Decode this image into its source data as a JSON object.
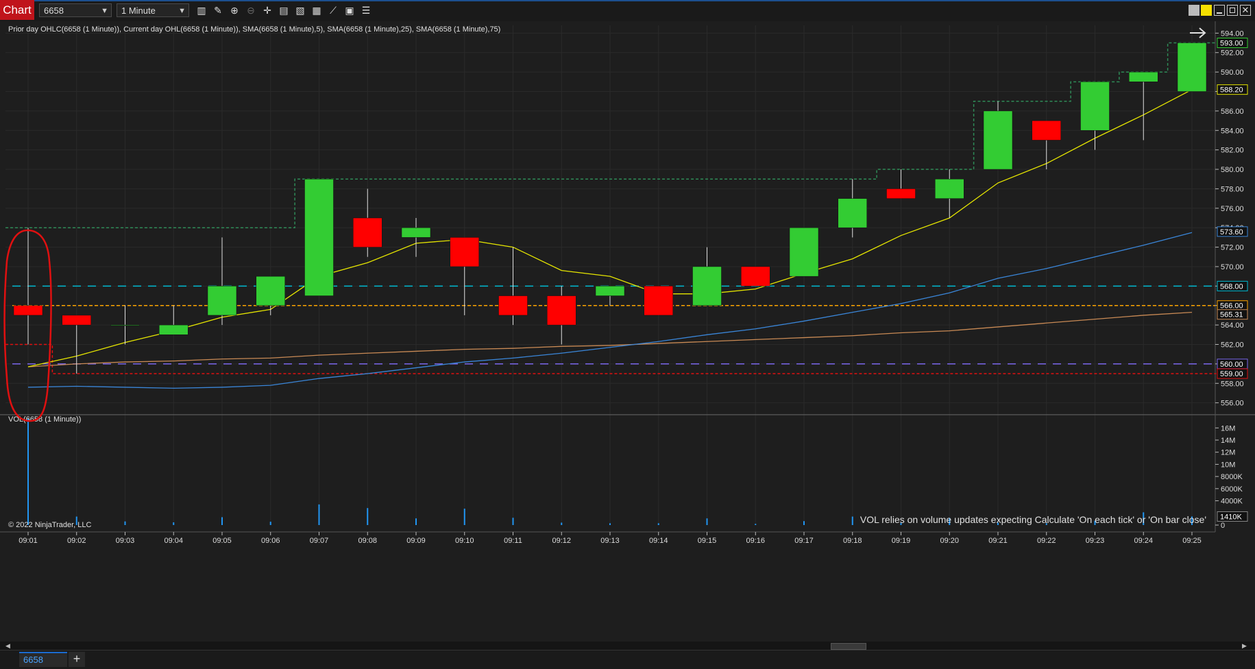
{
  "toolbar": {
    "tab_label": "Chart",
    "instrument": "6658",
    "interval": "1 Minute",
    "icons": [
      "bar-type-icon",
      "drawing-tool-icon",
      "zoom-in-icon",
      "zoom-out-icon",
      "crosshair-icon",
      "data-box-icon",
      "templates-icon",
      "strategies-icon",
      "indicators-icon",
      "properties-icon",
      "list-icon"
    ]
  },
  "colors": {
    "up": "#33cc33",
    "down": "#ff0000",
    "sma5": "#e6e600",
    "sma25": "#3a86d9",
    "sma75": "#c98a55",
    "prior_high": "#2e8b57",
    "prior_close": "#00bcd4",
    "current_open": "#ffa500",
    "prior_low": "#7b68ee",
    "current_low": "#e01010",
    "volume": "#2196f3",
    "annotation": "#e01010"
  },
  "chart_data": {
    "type": "candlestick",
    "indicator_label": "Prior day OHLC(6658 (1 Minute)), Current day OHL(6658 (1 Minute)), SMA(6658 (1 Minute),5), SMA(6658 (1 Minute),25), SMA(6658 (1 Minute),75)",
    "volume_label": "VOL(6658 (1 Minute))",
    "copyright": "© 2022 NinjaTrader, LLC",
    "volume_note": "VOL relies on volume updates expecting Calculate 'On each tick' or 'On bar close'",
    "categories": [
      "09:01",
      "09:02",
      "09:03",
      "09:04",
      "09:05",
      "09:06",
      "09:07",
      "09:08",
      "09:09",
      "09:10",
      "09:11",
      "09:12",
      "09:13",
      "09:14",
      "09:15",
      "09:16",
      "09:17",
      "09:18",
      "09:19",
      "09:20",
      "09:21",
      "09:22",
      "09:23",
      "09:24",
      "09:25"
    ],
    "ohlc": [
      [
        566,
        574,
        562,
        565
      ],
      [
        565,
        565,
        559,
        564
      ],
      [
        564,
        566,
        562,
        564
      ],
      [
        563,
        566,
        563,
        564
      ],
      [
        565,
        573,
        564,
        568
      ],
      [
        566,
        568,
        565,
        569
      ],
      [
        567,
        579,
        567,
        579
      ],
      [
        575,
        578,
        571,
        572
      ],
      [
        573,
        575,
        571,
        574
      ],
      [
        573,
        573,
        565,
        570
      ],
      [
        567,
        572,
        564,
        565
      ],
      [
        567,
        568,
        562,
        564
      ],
      [
        567,
        568,
        566,
        568
      ],
      [
        568,
        568,
        565,
        565
      ],
      [
        566,
        572,
        566,
        570
      ],
      [
        570,
        570,
        568,
        568
      ],
      [
        569,
        574,
        569,
        574
      ],
      [
        574,
        579,
        573,
        577
      ],
      [
        578,
        580,
        577,
        577
      ],
      [
        577,
        580,
        575,
        579
      ],
      [
        580,
        587,
        580,
        586
      ],
      [
        585,
        585,
        580,
        583
      ],
      [
        584,
        589,
        582,
        589
      ],
      [
        589,
        590,
        583,
        590
      ],
      [
        588,
        593,
        588,
        593
      ]
    ],
    "sma5": [
      559.7,
      560.8,
      562.2,
      563.4,
      564.8,
      565.6,
      569.0,
      570.4,
      572.4,
      572.8,
      572.0,
      569.6,
      569.0,
      567.2,
      567.2,
      567.7,
      569.3,
      570.8,
      573.2,
      575.0,
      578.6,
      580.6,
      583.2,
      585.6,
      588.2
    ],
    "sma25": [
      557.6,
      557.7,
      557.6,
      557.5,
      557.6,
      557.8,
      558.5,
      559.0,
      559.6,
      560.2,
      560.6,
      561.1,
      561.7,
      562.3,
      563.0,
      563.6,
      564.4,
      565.3,
      566.2,
      567.3,
      568.8,
      569.8,
      571.0,
      572.2,
      573.5
    ],
    "sma75": [
      559.7,
      560.0,
      560.2,
      560.3,
      560.5,
      560.6,
      560.9,
      561.1,
      561.3,
      561.5,
      561.6,
      561.8,
      561.9,
      562.1,
      562.3,
      562.5,
      562.7,
      562.9,
      563.2,
      563.4,
      563.8,
      564.2,
      564.6,
      565.0,
      565.3
    ],
    "prior_high": 574,
    "prior_close": 568,
    "prior_low": 560,
    "current_open": 566,
    "current_high_steps": [
      574,
      574,
      574,
      574,
      574,
      574,
      579,
      579,
      579,
      579,
      579,
      579,
      579,
      579,
      579,
      579,
      579,
      579,
      580,
      580,
      587,
      587,
      589,
      590,
      593
    ],
    "current_low_steps": [
      562,
      559,
      559,
      559,
      559,
      559,
      559,
      559,
      559,
      559,
      559,
      559,
      559,
      559,
      559,
      559,
      559,
      559,
      559,
      559,
      559,
      559,
      559,
      559,
      559
    ],
    "ylim": [
      555.2,
      594.8
    ],
    "y_ticks": [
      "594.00",
      "592.00",
      "590.00",
      "588.00",
      "586.00",
      "584.00",
      "582.00",
      "580.00",
      "578.00",
      "576.00",
      "574.00",
      "572.00",
      "570.00",
      "568.00",
      "566.00",
      "564.00",
      "562.00",
      "560.00",
      "558.00",
      "556.00"
    ],
    "y_tick_values": [
      594,
      592,
      590,
      588,
      586,
      584,
      582,
      580,
      578,
      576,
      574,
      572,
      570,
      568,
      566,
      564,
      562,
      560,
      558,
      556
    ],
    "price_markers": [
      {
        "label": "593.00",
        "value": 593.0,
        "color": "#33cc33"
      },
      {
        "label": "588.20",
        "value": 588.2,
        "color": "#e6e600"
      },
      {
        "label": "573.60",
        "value": 573.6,
        "color": "#3a86d9"
      },
      {
        "label": "568.00",
        "value": 568.0,
        "color": "#00bcd4"
      },
      {
        "label": "566.00",
        "value": 566.0,
        "color": "#ffa500"
      },
      {
        "label": "565.31",
        "value": 565.31,
        "color": "#c98a55"
      },
      {
        "label": "560.00",
        "value": 560.0,
        "color": "#7b68ee"
      },
      {
        "label": "559.00",
        "value": 559.0,
        "color": "#e01010"
      }
    ],
    "volume": [
      17500000,
      1400000,
      600000,
      450000,
      1300000,
      550000,
      3400000,
      2800000,
      1100000,
      2700000,
      1200000,
      400000,
      300000,
      300000,
      1100000,
      200000,
      650000,
      1400000,
      350000,
      1200000,
      400000,
      300000,
      700000,
      2100000,
      1410000
    ],
    "vol_ticks": [
      "16M",
      "14M",
      "12M",
      "10M",
      "8000K",
      "6000K",
      "4000K",
      "0"
    ],
    "vol_tick_values": [
      16000000,
      14000000,
      12000000,
      10000000,
      8000000,
      6000000,
      4000000,
      0
    ],
    "vol_marker": "1410K",
    "vol_marker_value": 1410000,
    "vol_max": 17500000
  },
  "bottom_tabs": {
    "instrument_tab": "6658",
    "add_tab": "+"
  }
}
